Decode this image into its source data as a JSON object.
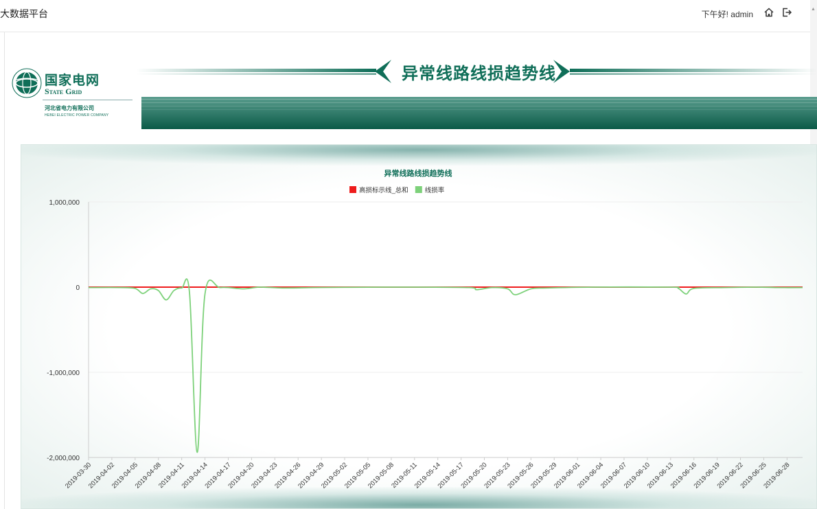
{
  "app": {
    "title": "大数据平台",
    "greeting": "下午好! admin",
    "home_icon": "home-icon",
    "logout_icon": "logout-icon"
  },
  "banner": {
    "title": "异常线路线损趋势线",
    "logo_cn": "国家电网",
    "logo_en": "State Grid",
    "company_cn": "河北省电力有限公司",
    "company_en": "HEBEI ELECTRIC POWER COMPANY"
  },
  "colors": {
    "brand": "#0f6e58",
    "series_red": "#ee1c1c",
    "series_green": "#7dd17a"
  },
  "chart_data": {
    "type": "line",
    "title": "异常线路线损趋势线",
    "legend_position": "top-center",
    "ylim": [
      -2000000,
      1000000
    ],
    "yticks": [
      1000000,
      0,
      -1000000,
      -2000000
    ],
    "ytick_labels": [
      "1,000,000",
      "0",
      "-1,000,000",
      "-2,000,000"
    ],
    "xticks": [
      "2019-03-30",
      "2019-04-02",
      "2019-04-05",
      "2019-04-08",
      "2019-04-11",
      "2019-04-14",
      "2019-04-17",
      "2019-04-20",
      "2019-04-23",
      "2019-04-26",
      "2019-04-29",
      "2019-05-02",
      "2019-05-05",
      "2019-05-08",
      "2019-05-11",
      "2019-05-14",
      "2019-05-17",
      "2019-05-20",
      "2019-05-23",
      "2019-05-26",
      "2019-05-29",
      "2019-06-01",
      "2019-06-04",
      "2019-06-07",
      "2019-06-10",
      "2019-06-13",
      "2019-06-16",
      "2019-06-19",
      "2019-06-22",
      "2019-06-25",
      "2019-06-28"
    ],
    "x_start": "2019-03-30",
    "x_end": "2019-06-30",
    "grid": true,
    "series": [
      {
        "name": "高损标示线_总和",
        "color": "#ee1c1c",
        "points": [
          [
            "2019-03-30",
            0
          ],
          [
            "2019-04-30",
            0
          ],
          [
            "2019-05-31",
            0
          ],
          [
            "2019-06-30",
            0
          ]
        ]
      },
      {
        "name": "线损率",
        "color": "#7dd17a",
        "points": [
          [
            "2019-03-30",
            -5000
          ],
          [
            "2019-04-03",
            -5000
          ],
          [
            "2019-04-05",
            -15000
          ],
          [
            "2019-04-06",
            -75000
          ],
          [
            "2019-04-07",
            -20000
          ],
          [
            "2019-04-08",
            -40000
          ],
          [
            "2019-04-09",
            -150000
          ],
          [
            "2019-04-10",
            -40000
          ],
          [
            "2019-04-11",
            -10000
          ],
          [
            "2019-04-12",
            -60000
          ],
          [
            "2019-04-13",
            -1940000
          ],
          [
            "2019-04-14",
            -80000
          ],
          [
            "2019-04-16",
            -5000
          ],
          [
            "2019-04-19",
            -20000
          ],
          [
            "2019-04-21",
            0
          ],
          [
            "2019-04-24",
            -10000
          ],
          [
            "2019-04-28",
            -5000
          ],
          [
            "2019-05-02",
            -2000
          ],
          [
            "2019-05-10",
            0
          ],
          [
            "2019-05-18",
            -5000
          ],
          [
            "2019-05-19",
            -30000
          ],
          [
            "2019-05-21",
            -5000
          ],
          [
            "2019-05-23",
            -20000
          ],
          [
            "2019-05-24",
            -90000
          ],
          [
            "2019-05-26",
            -20000
          ],
          [
            "2019-05-28",
            -10000
          ],
          [
            "2019-06-03",
            0
          ],
          [
            "2019-06-13",
            0
          ],
          [
            "2019-06-14",
            -15000
          ],
          [
            "2019-06-15",
            -80000
          ],
          [
            "2019-06-16",
            -15000
          ],
          [
            "2019-06-20",
            -5000
          ],
          [
            "2019-06-24",
            0
          ],
          [
            "2019-06-27",
            -5000
          ],
          [
            "2019-06-30",
            -5000
          ]
        ]
      }
    ]
  }
}
